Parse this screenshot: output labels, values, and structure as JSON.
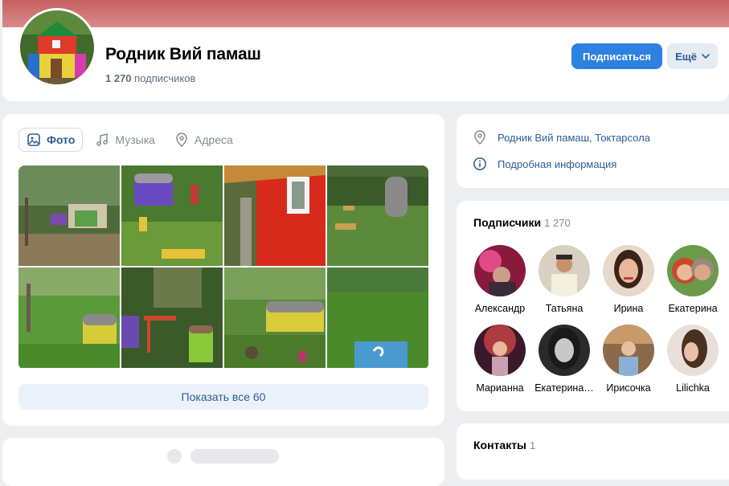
{
  "header": {
    "group_name": "Родник Вий памаш",
    "subscribers_count": "1 270",
    "subscribers_word": "подписчиков",
    "subscribe_label": "Подписаться",
    "more_label": "Ещё"
  },
  "media": {
    "tabs": [
      {
        "label": "Фото",
        "icon": "photo-icon",
        "active": true
      },
      {
        "label": "Музыка",
        "icon": "music-note-icon",
        "active": false
      },
      {
        "label": "Адреса",
        "icon": "map-pin-icon",
        "active": false
      }
    ],
    "show_all_label": "Показать все 60"
  },
  "info": {
    "address": "Родник Вий памаш, Токтарсола",
    "details": "Подробная информация"
  },
  "subscribers": {
    "title": "Подписчики",
    "count": "1 270",
    "people": [
      {
        "name": "Александр"
      },
      {
        "name": "Татьяна"
      },
      {
        "name": "Ирина"
      },
      {
        "name": "Екатерина"
      },
      {
        "name": "Марианна"
      },
      {
        "name": "Екатерина…"
      },
      {
        "name": "Ирисочка"
      },
      {
        "name": "Lilichka"
      }
    ]
  },
  "contacts": {
    "title": "Контакты",
    "count": "1"
  },
  "colors": {
    "accent": "#2d81e0",
    "link": "#2c5d94",
    "cover": "#c56060"
  }
}
